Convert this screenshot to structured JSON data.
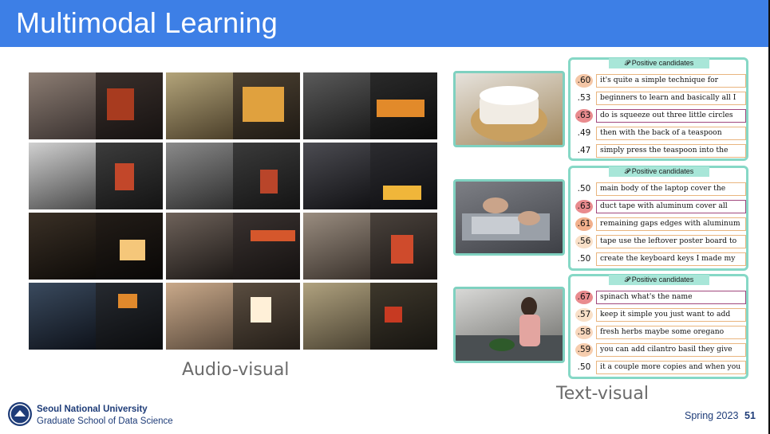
{
  "slide": {
    "title": "Multimodal Learning",
    "page_number": "51",
    "term": "Spring 2023"
  },
  "footer": {
    "university": "Seoul National University",
    "school": "Graduate School of Data Science"
  },
  "audio_visual": {
    "caption": "Audio-visual"
  },
  "text_visual": {
    "caption": "Text-visual",
    "groups": [
      {
        "header": "Positive candidates",
        "rows": [
          {
            "score": ".60",
            "text": "it's quite a simple technique for",
            "highlight": false
          },
          {
            "score": ".53",
            "text": "beginners to learn and basically all I",
            "highlight": false
          },
          {
            "score": ".63",
            "text": "do is squeeze out three little circles",
            "highlight": true
          },
          {
            "score": ".49",
            "text": "then with the back of a teaspoon",
            "highlight": false
          },
          {
            "score": ".47",
            "text": "simply press the teaspoon into the",
            "highlight": false
          }
        ]
      },
      {
        "header": "Positive candidates",
        "rows": [
          {
            "score": ".50",
            "text": "main body of the laptop cover the",
            "highlight": false
          },
          {
            "score": ".63",
            "text": "duct tape with aluminum cover all",
            "highlight": true
          },
          {
            "score": ".61",
            "text": "remaining gaps edges with aluminum",
            "highlight": false
          },
          {
            "score": ".56",
            "text": "tape use the leftover poster board to",
            "highlight": false
          },
          {
            "score": ".50",
            "text": "create the keyboard keys I made my",
            "highlight": false
          }
        ]
      },
      {
        "header": "Positive candidates",
        "rows": [
          {
            "score": ".67",
            "text": "spinach what's the name",
            "highlight": true
          },
          {
            "score": ".57",
            "text": "keep it simple you just want to add",
            "highlight": false
          },
          {
            "score": ".58",
            "text": "fresh herbs maybe some oregano",
            "highlight": false
          },
          {
            "score": ".59",
            "text": "you can add cilantro basil they give",
            "highlight": false
          },
          {
            "score": ".50",
            "text": "it a couple more copies and when you",
            "highlight": false
          }
        ]
      }
    ]
  },
  "colors": {
    "title_bar": "#3d7fe6",
    "candidate_border": "#86d8c6",
    "highlight_border": "#a1487d",
    "normal_border": "#e9b57f"
  }
}
